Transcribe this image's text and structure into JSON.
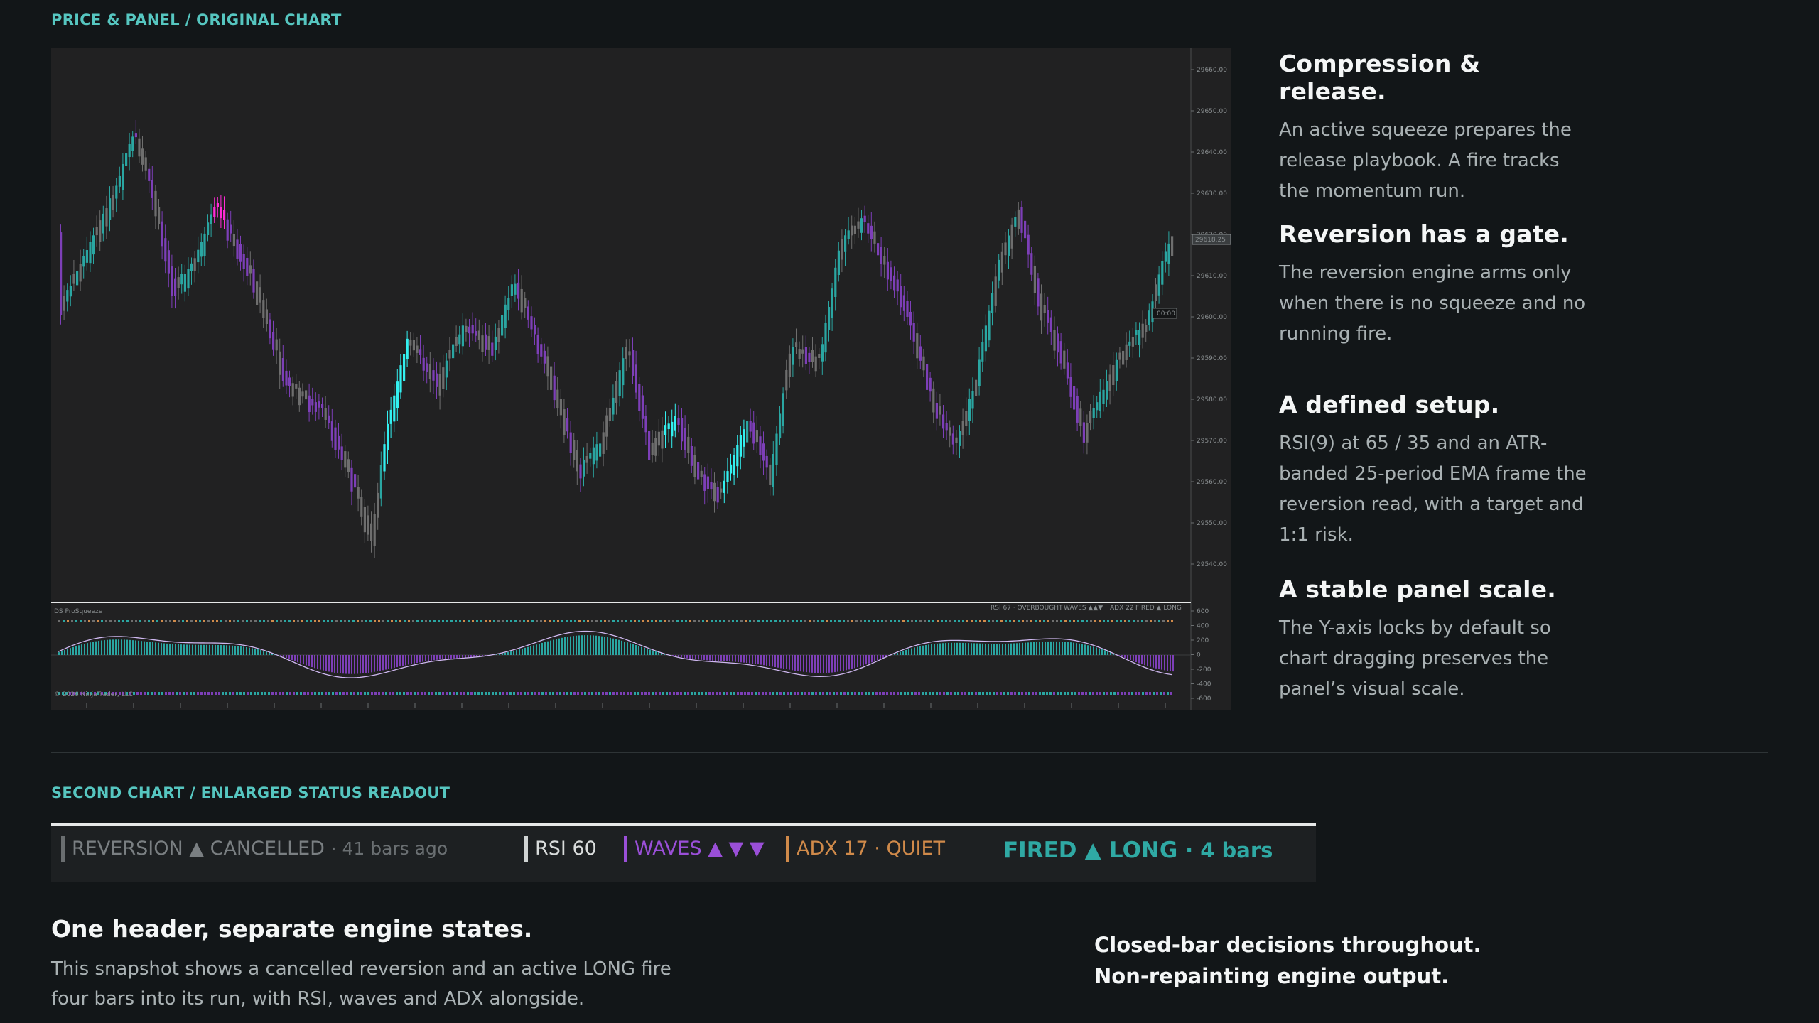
{
  "sections": {
    "top_label": "PRICE & PANEL / ORIGINAL CHART",
    "second_label": "SECOND CHART / ENLARGED STATUS READOUT"
  },
  "chart": {
    "price_ticks": [
      "29660.00",
      "29650.00",
      "29640.00",
      "29630.00",
      "29620.00",
      "29610.00",
      "29600.00",
      "29590.00",
      "29580.00",
      "29570.00",
      "29560.00",
      "29550.00",
      "29540.00"
    ],
    "last_price": "29618.25",
    "countdown": "00:00",
    "panel_title": "DS ProSqueeze",
    "panel_ticks": [
      "600",
      "400",
      "200",
      "0",
      "-200",
      "-400",
      "-600"
    ],
    "panel_copyright": "© 2026 NinjaTrader, LLC",
    "mini_status": {
      "rsi": "RSI 67 · OVERBOUGHT",
      "waves": "WAVES ▲▲▼",
      "adx": "ADX 22",
      "fired": "FIRED ▲ LONG"
    },
    "colors": {
      "bull": "#2aa6a2",
      "bull_bright": "#33f0f0",
      "bear": "#7d3fb8",
      "neutral": "#6e6e6e",
      "magenta": "#ff2bd6"
    }
  },
  "sidebar": [
    {
      "title": "Compression & release.",
      "body": "An active squeeze prepares the release playbook. A fire tracks the momentum run."
    },
    {
      "title": "Reversion has a gate.",
      "body": "The reversion engine arms only when there is no squeeze and no running fire."
    },
    {
      "title": "A defined setup.",
      "body": "RSI(9) at 65 / 35 and an ATR-banded 25-period EMA frame the reversion read, with a target and 1:1 risk."
    },
    {
      "title": "A stable panel scale.",
      "body": "The Y-axis locks by default so chart dragging preserves the panel’s visual scale."
    }
  ],
  "status": {
    "reversion": "REVERSION ▲ CANCELLED",
    "reversion_age": "· 41 bars ago",
    "rsi": "RSI 60",
    "waves": "WAVES ▲ ▼ ▼",
    "adx": "ADX 17",
    "adx_state": "· QUIET",
    "fired": "FIRED",
    "fired_dir": "▲ LONG",
    "fired_age": "· 4 bars",
    "colors": {
      "reversion": "#7a7f82",
      "rsi": "#d9dcdc",
      "waves": "#9a4fd8",
      "adx": "#d08a4a",
      "fired": "#2fa9a4"
    }
  },
  "bottom": {
    "heading": "One header, separate engine states.",
    "body": "This snapshot shows a cancelled reversion and an active LONG fire four bars into its run, with RSI, waves and ADX alongside.",
    "closed_line1": "Closed-bar decisions throughout.",
    "closed_line2": "Non-repainting engine output."
  }
}
